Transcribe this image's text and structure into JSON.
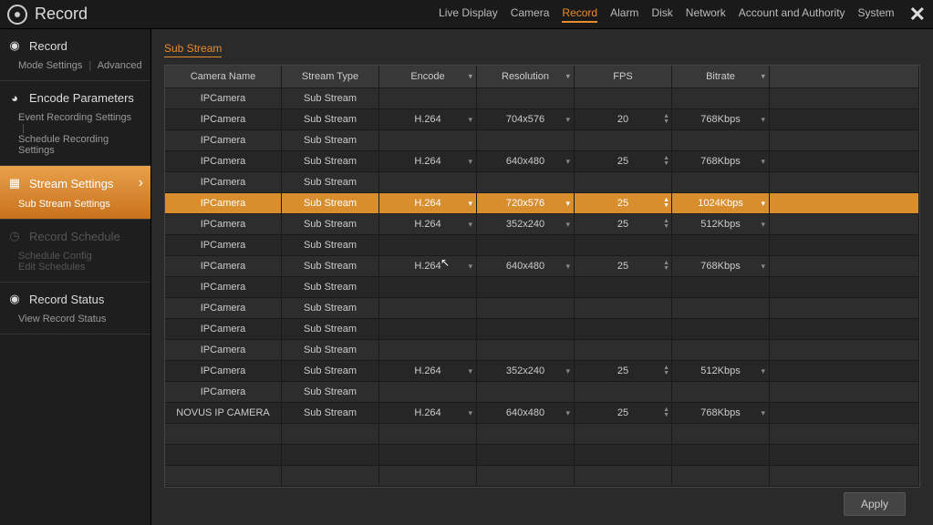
{
  "app": {
    "title": "Record"
  },
  "nav": {
    "items": [
      "Live Display",
      "Camera",
      "Record",
      "Alarm",
      "Disk",
      "Network",
      "Account and Authority",
      "System"
    ],
    "active": "Record"
  },
  "sidebar": {
    "record": {
      "title": "Record",
      "mode": "Mode Settings",
      "adv": "Advanced"
    },
    "encode": {
      "title": "Encode Parameters",
      "evt": "Event Recording Settings",
      "sch": "Schedule Recording Settings"
    },
    "stream": {
      "title": "Stream Settings",
      "sub": "Sub Stream Settings"
    },
    "schedule": {
      "title": "Record Schedule",
      "cfg": "Schedule Config",
      "edit": "Edit Schedules"
    },
    "status": {
      "title": "Record Status",
      "view": "View Record Status"
    }
  },
  "tab": "Sub Stream",
  "headers": {
    "name": "Camera Name",
    "type": "Stream Type",
    "enc": "Encode",
    "res": "Resolution",
    "fps": "FPS",
    "bit": "Bitrate"
  },
  "rows": [
    {
      "name": "IPCamera",
      "type": "Sub Stream",
      "enc": "",
      "res": "",
      "fps": "",
      "bit": ""
    },
    {
      "name": "IPCamera",
      "type": "Sub Stream",
      "enc": "H.264",
      "res": "704x576",
      "fps": "20",
      "bit": "768Kbps"
    },
    {
      "name": "IPCamera",
      "type": "Sub Stream",
      "enc": "",
      "res": "",
      "fps": "",
      "bit": ""
    },
    {
      "name": "IPCamera",
      "type": "Sub Stream",
      "enc": "H.264",
      "res": "640x480",
      "fps": "25",
      "bit": "768Kbps"
    },
    {
      "name": "IPCamera",
      "type": "Sub Stream",
      "enc": "",
      "res": "",
      "fps": "",
      "bit": ""
    },
    {
      "name": "IPCamera",
      "type": "Sub Stream",
      "enc": "H.264",
      "res": "720x576",
      "fps": "25",
      "bit": "1024Kbps",
      "hl": true
    },
    {
      "name": "IPCamera",
      "type": "Sub Stream",
      "enc": "H.264",
      "res": "352x240",
      "fps": "25",
      "bit": "512Kbps"
    },
    {
      "name": "IPCamera",
      "type": "Sub Stream",
      "enc": "",
      "res": "",
      "fps": "",
      "bit": ""
    },
    {
      "name": "IPCamera",
      "type": "Sub Stream",
      "enc": "H.264",
      "res": "640x480",
      "fps": "25",
      "bit": "768Kbps"
    },
    {
      "name": "IPCamera",
      "type": "Sub Stream",
      "enc": "",
      "res": "",
      "fps": "",
      "bit": ""
    },
    {
      "name": "IPCamera",
      "type": "Sub Stream",
      "enc": "",
      "res": "",
      "fps": "",
      "bit": ""
    },
    {
      "name": "IPCamera",
      "type": "Sub Stream",
      "enc": "",
      "res": "",
      "fps": "",
      "bit": ""
    },
    {
      "name": "IPCamera",
      "type": "Sub Stream",
      "enc": "",
      "res": "",
      "fps": "",
      "bit": ""
    },
    {
      "name": "IPCamera",
      "type": "Sub Stream",
      "enc": "H.264",
      "res": "352x240",
      "fps": "25",
      "bit": "512Kbps"
    },
    {
      "name": "IPCamera",
      "type": "Sub Stream",
      "enc": "",
      "res": "",
      "fps": "",
      "bit": ""
    },
    {
      "name": "NOVUS IP CAMERA",
      "type": "Sub Stream",
      "enc": "H.264",
      "res": "640x480",
      "fps": "25",
      "bit": "768Kbps"
    },
    {
      "name": "",
      "type": "",
      "enc": "",
      "res": "",
      "fps": "",
      "bit": ""
    },
    {
      "name": "",
      "type": "",
      "enc": "",
      "res": "",
      "fps": "",
      "bit": ""
    },
    {
      "name": "",
      "type": "",
      "enc": "",
      "res": "",
      "fps": "",
      "bit": ""
    }
  ],
  "apply": "Apply"
}
